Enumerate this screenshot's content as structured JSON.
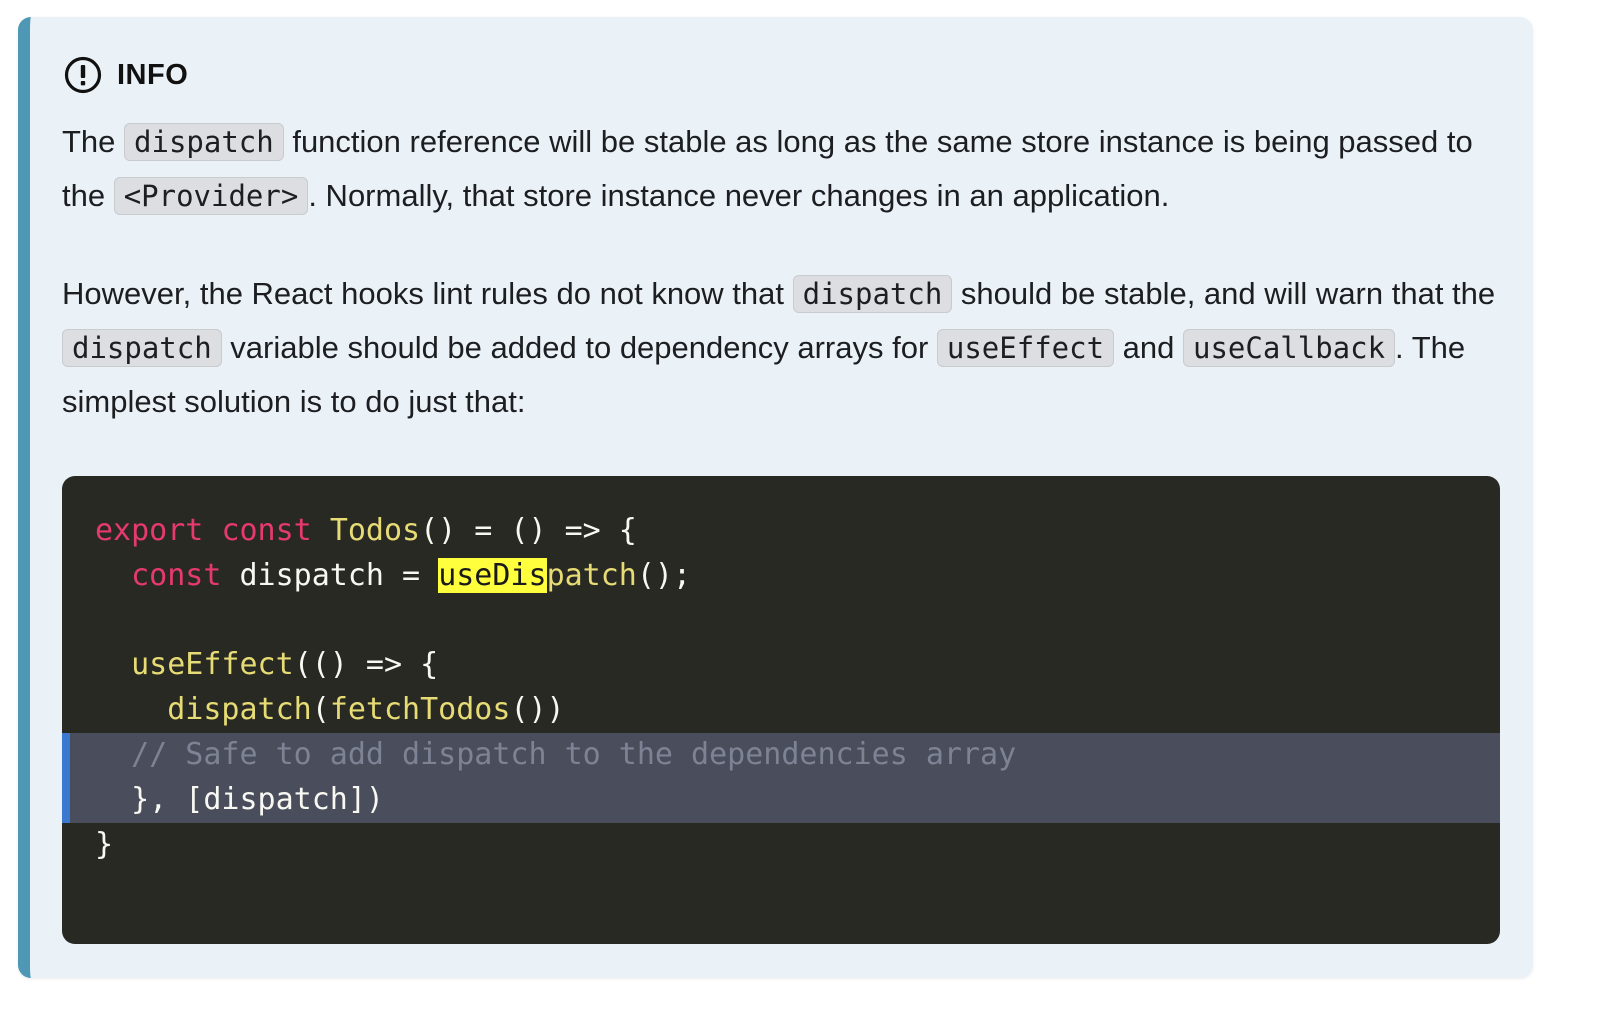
{
  "admonition": {
    "type": "info",
    "title": "INFO",
    "icon": "alert-circle-icon",
    "colors": {
      "accent": "#4e97b5",
      "background": "#ebf2f7"
    },
    "paragraphs": [
      {
        "segments": [
          {
            "text": "The ",
            "code": false
          },
          {
            "text": "dispatch",
            "code": true
          },
          {
            "text": " function reference will be stable as long as the same store instance is being passed to the ",
            "code": false
          },
          {
            "text": "<Provider>",
            "code": true
          },
          {
            "text": ". Normally, that store instance never changes in an application.",
            "code": false
          }
        ]
      },
      {
        "segments": [
          {
            "text": "However, the React hooks lint rules do not know that ",
            "code": false
          },
          {
            "text": "dispatch",
            "code": true
          },
          {
            "text": " should be stable, and will warn that the ",
            "code": false
          },
          {
            "text": "dispatch",
            "code": true
          },
          {
            "text": " variable should be added to dependency arrays for ",
            "code": false
          },
          {
            "text": "useEffect",
            "code": true
          },
          {
            "text": " and ",
            "code": false
          },
          {
            "text": "useCallback",
            "code": true
          },
          {
            "text": ". The simplest solution is to do just that:",
            "code": false
          }
        ]
      }
    ],
    "code_block": {
      "language": "javascript",
      "colors": {
        "background": "#282923",
        "highlight": "#4a4d5b",
        "highlight_bar": "#3b79d0",
        "search_match": "#ffff3d"
      },
      "lines": [
        {
          "highlighted": false,
          "tokens": [
            {
              "t": "export",
              "c": "kw"
            },
            {
              "t": " ",
              "c": "pl"
            },
            {
              "t": "const",
              "c": "kw"
            },
            {
              "t": " ",
              "c": "pl"
            },
            {
              "t": "Todos",
              "c": "fn"
            },
            {
              "t": "() = () => {",
              "c": "pl"
            }
          ]
        },
        {
          "highlighted": false,
          "tokens": [
            {
              "t": "  ",
              "c": "pl"
            },
            {
              "t": "const",
              "c": "kw"
            },
            {
              "t": " dispatch = ",
              "c": "pl"
            },
            {
              "t": "useDis",
              "c": "mark"
            },
            {
              "t": "patch",
              "c": "fn"
            },
            {
              "t": "();",
              "c": "pl"
            }
          ]
        },
        {
          "highlighted": false,
          "tokens": [
            {
              "t": "",
              "c": "pl"
            }
          ]
        },
        {
          "highlighted": false,
          "tokens": [
            {
              "t": "  ",
              "c": "pl"
            },
            {
              "t": "useEffect",
              "c": "fn"
            },
            {
              "t": "(() => {",
              "c": "pl"
            }
          ]
        },
        {
          "highlighted": false,
          "tokens": [
            {
              "t": "    ",
              "c": "pl"
            },
            {
              "t": "dispatch",
              "c": "fn"
            },
            {
              "t": "(",
              "c": "pl"
            },
            {
              "t": "fetchTodos",
              "c": "fn"
            },
            {
              "t": "())",
              "c": "pl"
            }
          ]
        },
        {
          "highlighted": true,
          "tokens": [
            {
              "t": "  ",
              "c": "pl"
            },
            {
              "t": "// Safe to add dispatch to the dependencies array",
              "c": "cm"
            }
          ]
        },
        {
          "highlighted": true,
          "tokens": [
            {
              "t": "  }, [dispatch])",
              "c": "pl"
            }
          ]
        },
        {
          "highlighted": false,
          "tokens": [
            {
              "t": "}",
              "c": "pl"
            }
          ]
        }
      ]
    }
  }
}
